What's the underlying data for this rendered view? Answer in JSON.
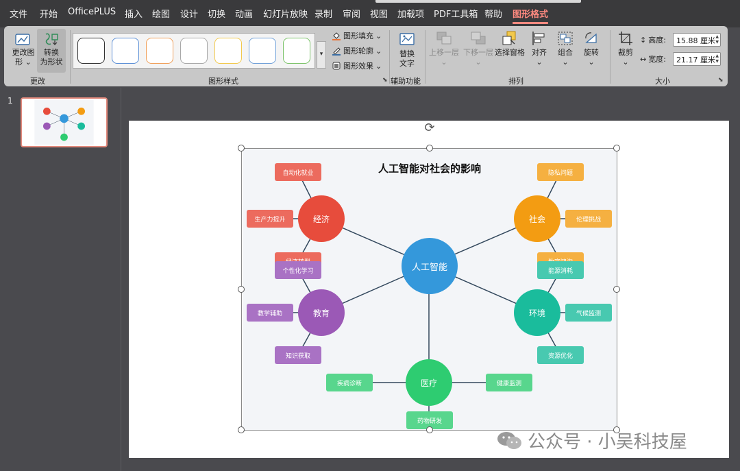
{
  "menu": {
    "tabs": [
      "文件",
      "开始",
      "OfficePLUS",
      "插入",
      "绘图",
      "设计",
      "切换",
      "动画",
      "幻灯片放映",
      "录制",
      "审阅",
      "视图",
      "加载项",
      "PDF工具箱",
      "帮助",
      "图形格式"
    ],
    "active_tab": "图形格式"
  },
  "ribbon": {
    "change_group": {
      "label": "更改",
      "change_shape": "更改图形",
      "convert_shape_1": "转换",
      "convert_shape_2": "为形状"
    },
    "styles_group": {
      "label": "图形样式",
      "fill": "图形填充",
      "outline": "图形轮廓",
      "effects": "图形效果",
      "swatch_colors": [
        "#333333",
        "#5b8fd6",
        "#f0a05a",
        "#a8a8a8",
        "#f2c94c",
        "#6fa0d8",
        "#7cc36a"
      ]
    },
    "accessibility_group": {
      "label": "辅助功能",
      "alt_text_1": "替换",
      "alt_text_2": "文字"
    },
    "arrange_group": {
      "label": "排列",
      "bring_forward": "上移一层",
      "send_backward": "下移一层",
      "selection_pane": "选择窗格",
      "align": "对齐",
      "group": "组合",
      "rotate": "旋转"
    },
    "size_group": {
      "label": "大小",
      "crop": "裁剪",
      "height_label": "高度:",
      "height_value": "15.88 厘米",
      "width_label": "宽度:",
      "width_value": "21.17 厘米"
    }
  },
  "slides_pane": {
    "slide_number": "1"
  },
  "diagram": {
    "title": "人工智能对社会的影响",
    "center": {
      "label": "人工智能",
      "color": "#3498db"
    },
    "hubs": [
      {
        "id": "economy",
        "label": "经济",
        "color": "#e74c3c",
        "leaf_color": "#ec6b5e",
        "leaves": [
          "自动化就业",
          "生产力提升",
          "经济转型"
        ]
      },
      {
        "id": "society",
        "label": "社会",
        "color": "#f39c12",
        "leaf_color": "#f5b041",
        "leaves": [
          "隐私问题",
          "伦理挑战",
          "数字鸿沟"
        ]
      },
      {
        "id": "education",
        "label": "教育",
        "color": "#9b59b6",
        "leaf_color": "#a972c4",
        "leaves": [
          "个性化学习",
          "教学辅助",
          "知识获取"
        ]
      },
      {
        "id": "environment",
        "label": "环境",
        "color": "#1abc9c",
        "leaf_color": "#48c9b0",
        "leaves": [
          "能源消耗",
          "气候监测",
          "资源优化"
        ]
      },
      {
        "id": "healthcare",
        "label": "医疗",
        "color": "#2ecc71",
        "leaf_color": "#58d68d",
        "leaves": [
          "疾病诊断",
          "健康监测",
          "药物研发"
        ]
      }
    ]
  },
  "watermark": {
    "text": "公众号 · 小吴科技屋"
  }
}
